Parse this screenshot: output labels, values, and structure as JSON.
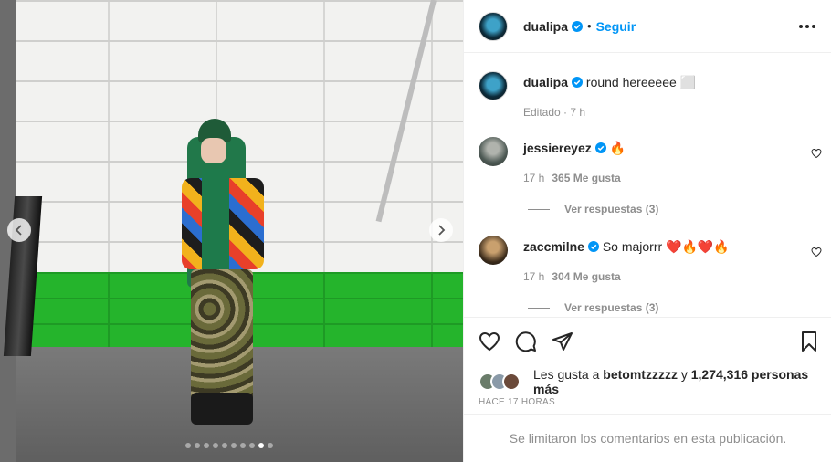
{
  "post": {
    "username": "dualipa",
    "follow_label": "Seguir",
    "separator": "•",
    "caption_text": "round hereeeee ⬜",
    "caption_meta": "Editado · 7 h"
  },
  "carousel": {
    "slide_count": 10,
    "active_index": 8
  },
  "comments": [
    {
      "username": "jessiereyez",
      "text": "🔥",
      "time": "17 h",
      "likes": "365 Me gusta",
      "replies": "Ver respuestas (3)"
    },
    {
      "username": "zaccmilne",
      "text": "So majorrr ❤️🔥❤️🔥",
      "time": "17 h",
      "likes": "304 Me gusta",
      "replies": "Ver respuestas (3)"
    }
  ],
  "likes": {
    "prefix": "Les gusta a ",
    "user": "betomtzzzzz",
    "middle": " y ",
    "count": "1,274,316 personas más"
  },
  "timestamp": "HACE 17 HORAS",
  "comments_limited": "Se limitaron los comentarios en esta publicación.",
  "colors": {
    "accent": "#0095f6",
    "muted": "#8e8e8e"
  }
}
